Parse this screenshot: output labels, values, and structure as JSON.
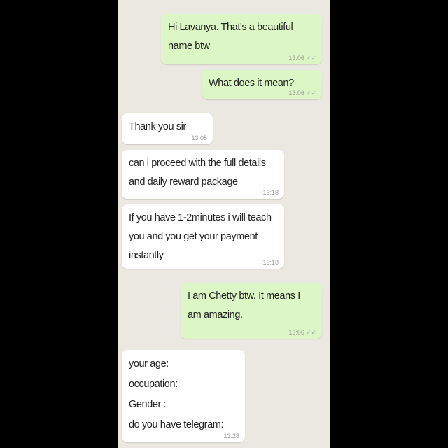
{
  "colors": {
    "outgoing_bubble": "#dcf7c5",
    "incoming_bubble": "#ffffff",
    "chat_background": "#ebe7e1",
    "tick_icon": "double-check-icon"
  },
  "messages": [
    {
      "direction": "outgoing",
      "text": "Hi Lavanya. That's a beautiful name btw",
      "time": "13:06",
      "ticks": "✓✓"
    },
    {
      "direction": "outgoing",
      "text": "What does it mean?",
      "time": "13:06",
      "ticks": "✓✓"
    },
    {
      "direction": "incoming",
      "text": "Thank you sir",
      "time": "13:05"
    },
    {
      "direction": "incoming",
      "text": "can i proceed with the full details and daily reward package",
      "time": "13:18"
    },
    {
      "direction": "incoming",
      "text": "If you have 1-2minutes i will teach you and you get your payment instantly",
      "time": "13:18"
    },
    {
      "direction": "outgoing",
      "text": "I am Chetty btw. It means I am amazing.",
      "time": "13:06",
      "ticks": "✓✓"
    },
    {
      "direction": "incoming",
      "text": "your age:\noccupation:\nGender :\ndo you have telegram:",
      "time": "13:28"
    }
  ]
}
